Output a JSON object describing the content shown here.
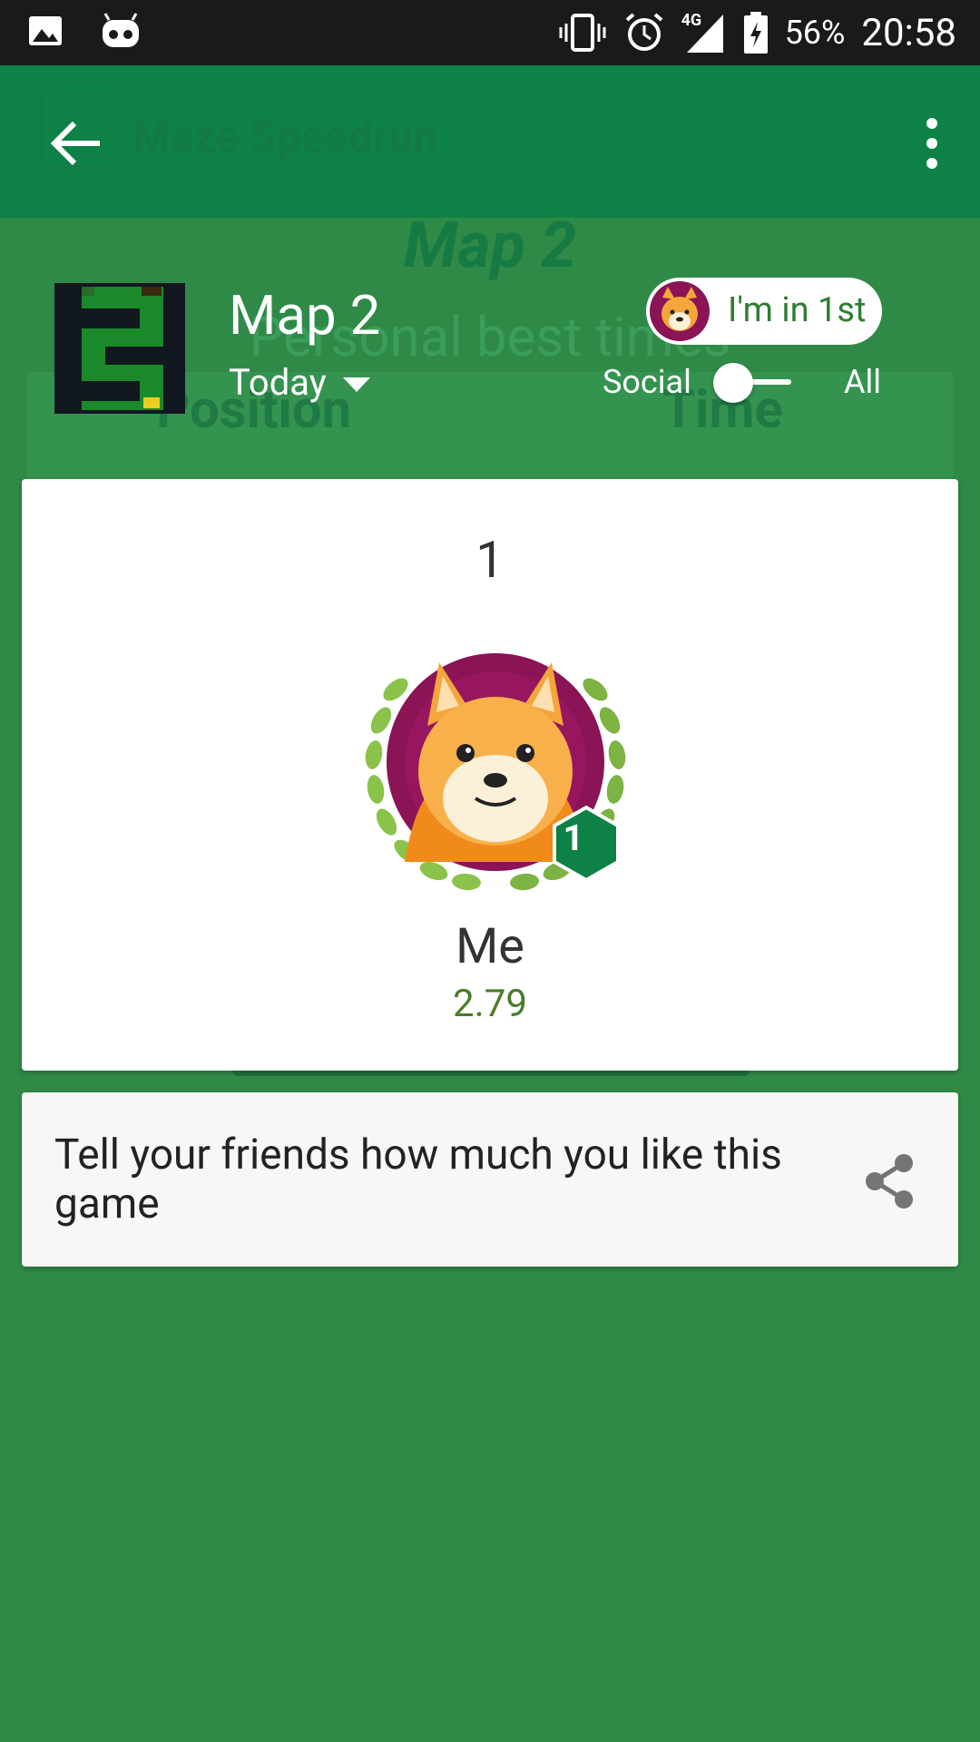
{
  "status_bar": {
    "battery_percent": "56%",
    "network": "4G",
    "time": "20:58",
    "icons": [
      "gallery-icon",
      "android-icon",
      "vibrate-icon",
      "alarm-icon",
      "signal-icon",
      "battery-icon"
    ]
  },
  "app_bar": {
    "ghost_title": "Maze Speedrun",
    "back_icon": "arrow-back-icon",
    "menu_icon": "more-vert-icon"
  },
  "background": {
    "map_heading": "Map 2",
    "subtitle": "Personal best times",
    "col_position": "Position",
    "col_time": "Time"
  },
  "header": {
    "map_title": "Map 2",
    "timespan": "Today",
    "rank_pill": "I'm in 1st",
    "toggle_left": "Social",
    "toggle_right": "All"
  },
  "player_card": {
    "rank": "1",
    "badge_rank": "1",
    "name": "Me",
    "score": "2.79"
  },
  "share": {
    "text": "Tell your friends how much you like this game",
    "icon": "share-icon"
  },
  "colors": {
    "background": "#2f8a47",
    "app_bar": "#0d8146",
    "badge": "#0d8146",
    "avatar_bg": "#8a1455",
    "score": "#4a7c2a"
  }
}
